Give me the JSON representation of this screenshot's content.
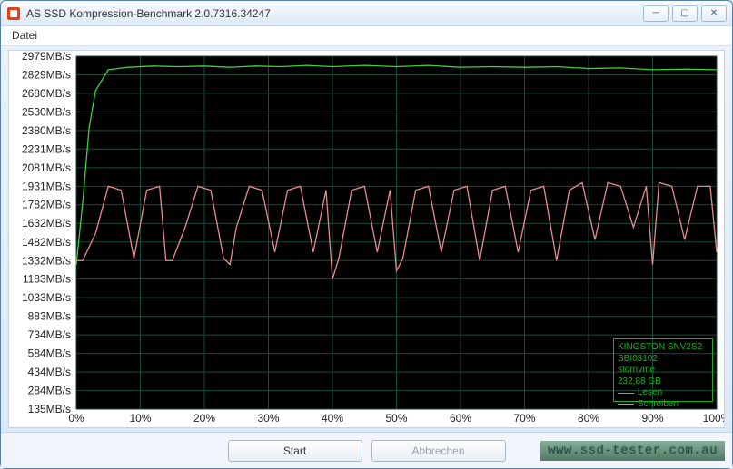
{
  "window": {
    "title": "AS SSD Kompression-Benchmark 2.0.7316.34247",
    "minimize": "─",
    "maximize": "▢",
    "close": "✕"
  },
  "menu": {
    "file": "Datei"
  },
  "legend": {
    "device": "KINGSTON SNV2S2",
    "fw": "SBI03102",
    "driver": "stornvme",
    "capacity": "232,88 GB",
    "read": "Lesen",
    "write": "Schreiben"
  },
  "buttons": {
    "start": "Start",
    "abort": "Abbrechen"
  },
  "watermark": "www.ssd-tester.com.au",
  "chart_data": {
    "type": "line",
    "title": "",
    "xlabel": "",
    "ylabel": "",
    "y_unit": "MB/s",
    "x_unit": "%",
    "y_ticks": [
      135,
      284,
      434,
      584,
      734,
      883,
      1033,
      1183,
      1332,
      1482,
      1632,
      1782,
      1931,
      2081,
      2231,
      2380,
      2530,
      2680,
      2829,
      2979
    ],
    "x_ticks": [
      0,
      10,
      20,
      30,
      40,
      50,
      60,
      70,
      80,
      90,
      100
    ],
    "ylim": [
      135,
      2979
    ],
    "xlim": [
      0,
      100
    ],
    "series": [
      {
        "name": "Lesen",
        "color": "#3fcf3f",
        "x": [
          0,
          1,
          2,
          3,
          5,
          8,
          12,
          16,
          20,
          24,
          28,
          32,
          36,
          40,
          45,
          50,
          55,
          60,
          65,
          70,
          75,
          80,
          85,
          90,
          95,
          100
        ],
        "y": [
          1300,
          1800,
          2400,
          2700,
          2870,
          2890,
          2900,
          2895,
          2900,
          2890,
          2900,
          2895,
          2905,
          2895,
          2905,
          2895,
          2905,
          2890,
          2895,
          2890,
          2895,
          2880,
          2885,
          2870,
          2875,
          2870
        ]
      },
      {
        "name": "Schreiben",
        "color": "#e88a8a",
        "x": [
          0,
          1,
          3,
          5,
          7,
          9,
          11,
          13,
          14,
          15,
          17,
          19,
          21,
          23,
          24,
          25,
          27,
          29,
          31,
          33,
          35,
          37,
          39,
          40,
          41,
          43,
          45,
          47,
          49,
          50,
          51,
          53,
          55,
          57,
          59,
          61,
          63,
          65,
          67,
          69,
          71,
          73,
          75,
          77,
          79,
          81,
          83,
          85,
          87,
          89,
          90,
          91,
          93,
          95,
          97,
          99,
          100
        ],
        "y": [
          1332,
          1332,
          1550,
          1931,
          1900,
          1350,
          1900,
          1931,
          1332,
          1332,
          1600,
          1931,
          1900,
          1350,
          1300,
          1600,
          1931,
          1900,
          1400,
          1900,
          1931,
          1400,
          1900,
          1183,
          1350,
          1900,
          1931,
          1400,
          1900,
          1250,
          1350,
          1900,
          1931,
          1400,
          1900,
          1931,
          1332,
          1900,
          1931,
          1400,
          1900,
          1931,
          1332,
          1900,
          1960,
          1500,
          1960,
          1931,
          1600,
          1931,
          1300,
          1960,
          1931,
          1500,
          1931,
          1931,
          1400
        ]
      }
    ]
  }
}
